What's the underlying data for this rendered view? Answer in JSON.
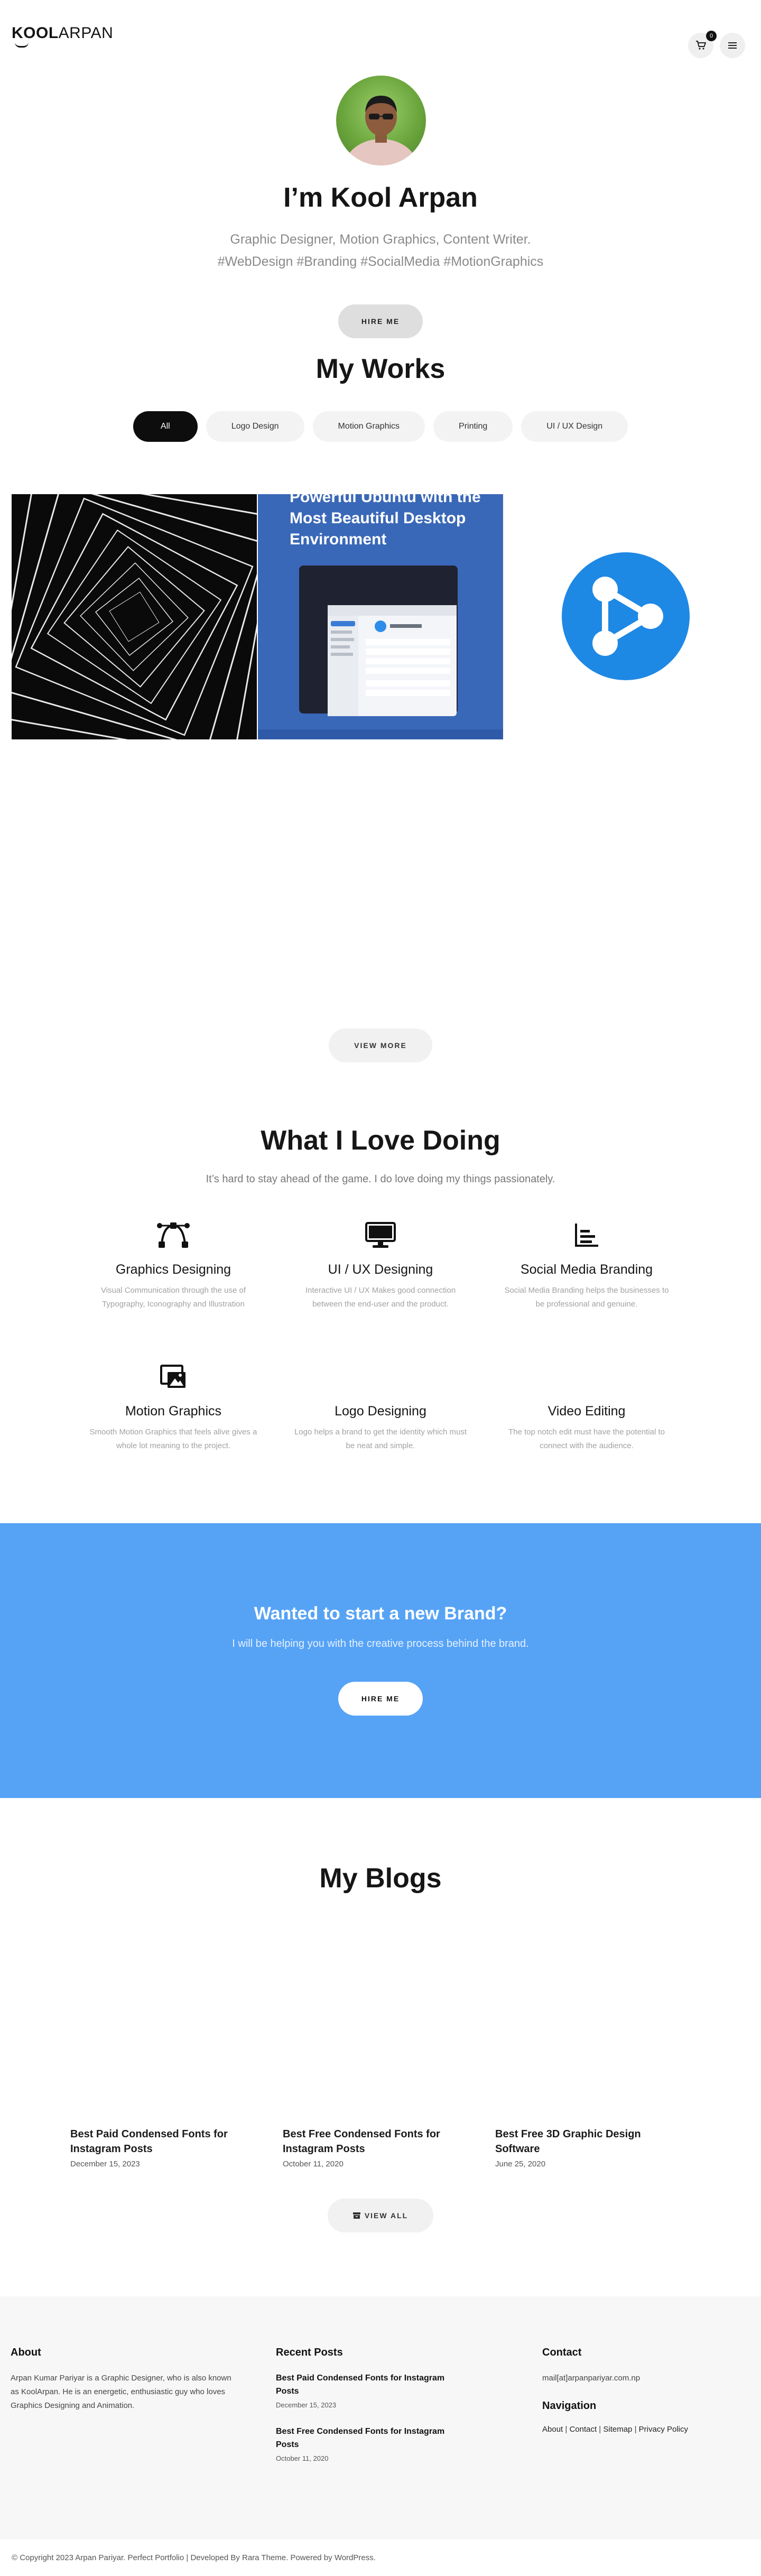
{
  "header": {
    "logo_bold": "KOOL",
    "logo_light": "ARPAN",
    "cart_count": "0"
  },
  "hero": {
    "title": "I’m Kool Arpan",
    "subtitle_line1": "Graphic Designer, Motion Graphics, Content Writer.",
    "subtitle_line2": "#WebDesign #Branding #SocialMedia #MotionGraphics",
    "hire_label": "HIRE ME"
  },
  "works": {
    "title": "My Works",
    "filters": [
      "All",
      "Logo Design",
      "Motion Graphics",
      "Printing",
      "UI / UX Design"
    ],
    "active_filter": "All",
    "items": [
      {
        "name": "abstract-squares"
      },
      {
        "name": "ubuntu-desktop",
        "heading": "Powerful Ubuntu with the Most Beautiful Desktop Environment"
      },
      {
        "name": "share-logo"
      }
    ],
    "view_more_label": "VIEW MORE"
  },
  "services": {
    "title": "What I Love Doing",
    "subtitle": "It’s hard to stay ahead of the game. I do love doing my things passionately.",
    "items": [
      {
        "icon": "bezier-curve-icon",
        "title": "Graphics Designing",
        "desc": "Visual Communication through the use of Typography, Iconography and Illustration"
      },
      {
        "icon": "desktop-icon",
        "title": "UI / UX Designing",
        "desc": "Interactive UI / UX Makes good connection between the end-user and the product."
      },
      {
        "icon": "bar-chart-icon",
        "title": "Social Media Branding",
        "desc": "Social Media Branding helps the businesses to be professional and genuine."
      },
      {
        "icon": "photo-video-icon",
        "title": "Motion Graphics",
        "desc": "Smooth Motion Graphics that feels alive gives a whole lot meaning to the project."
      },
      {
        "icon": "",
        "title": "Logo Designing",
        "desc": "Logo helps a brand to get the identity which must be neat and simple."
      },
      {
        "icon": "",
        "title": "Video Editing",
        "desc": "The top notch edit must have the potential to connect with the audience."
      }
    ]
  },
  "cta": {
    "title": "Wanted to start a new Brand?",
    "subtitle": "I will be helping you with the creative process behind the brand.",
    "button": "HIRE ME",
    "color": "#56a3f6"
  },
  "blogs": {
    "title": "My Blogs",
    "posts": [
      {
        "title": "Best Paid Condensed Fonts for Instagram Posts",
        "date": "December 15, 2023"
      },
      {
        "title": "Best Free Condensed Fonts for Instagram Posts",
        "date": "October 11, 2020"
      },
      {
        "title": "Best Free 3D Graphic Design Software",
        "date": "June 25, 2020"
      }
    ],
    "view_all_label": "VIEW ALL"
  },
  "footer": {
    "about_title": "About",
    "about_text": "Arpan Kumar Pariyar is a Graphic Designer, who is also known as KoolArpan. He is an energetic, enthusiastic guy who loves Graphics Designing and Animation.",
    "recent_title": "Recent Posts",
    "recent_posts": [
      {
        "title": "Best Paid Condensed Fonts for Instagram Posts",
        "date": "December 15, 2023"
      },
      {
        "title": "Best Free Condensed Fonts for Instagram Posts",
        "date": "October 11, 2020"
      }
    ],
    "contact_title": "Contact",
    "contact_email": "mail[at]arpanpariyar.com.np",
    "nav_title": "Navigation",
    "nav_links": [
      "About",
      "Contact",
      "Sitemap",
      "Privacy Policy"
    ],
    "copyright": "© Copyright 2023 Arpan Pariyar. Perfect Portfolio | Developed By Rara Theme. Powered by WordPress."
  }
}
